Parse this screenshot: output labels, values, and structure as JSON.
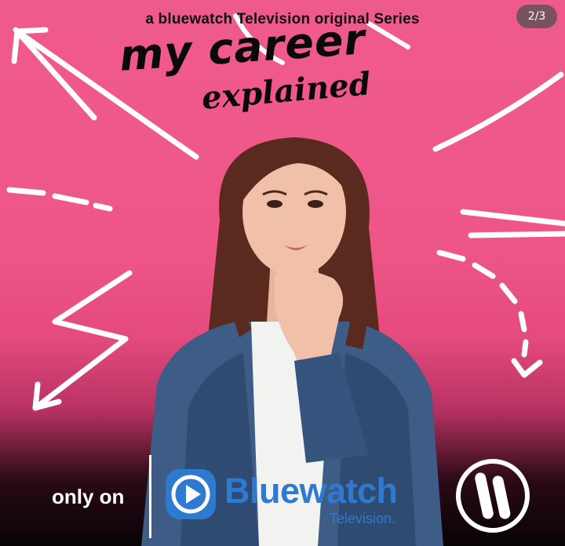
{
  "carousel": {
    "counter": "2/3"
  },
  "poster": {
    "subtitle": "a bluewatch Television original Series",
    "title_line1": "my career",
    "title_line2": "explained"
  },
  "footer": {
    "only_on": "only on",
    "brand_name": "Bluewatch",
    "brand_sub": "Television.",
    "brand_color": "#2e7ad0"
  },
  "colors": {
    "background": "#ef5a8c",
    "accent": "#2e7ad0"
  },
  "icons": [
    "play-circle-icon",
    "channel-logo-icon",
    "arrow-doodle-icon"
  ]
}
